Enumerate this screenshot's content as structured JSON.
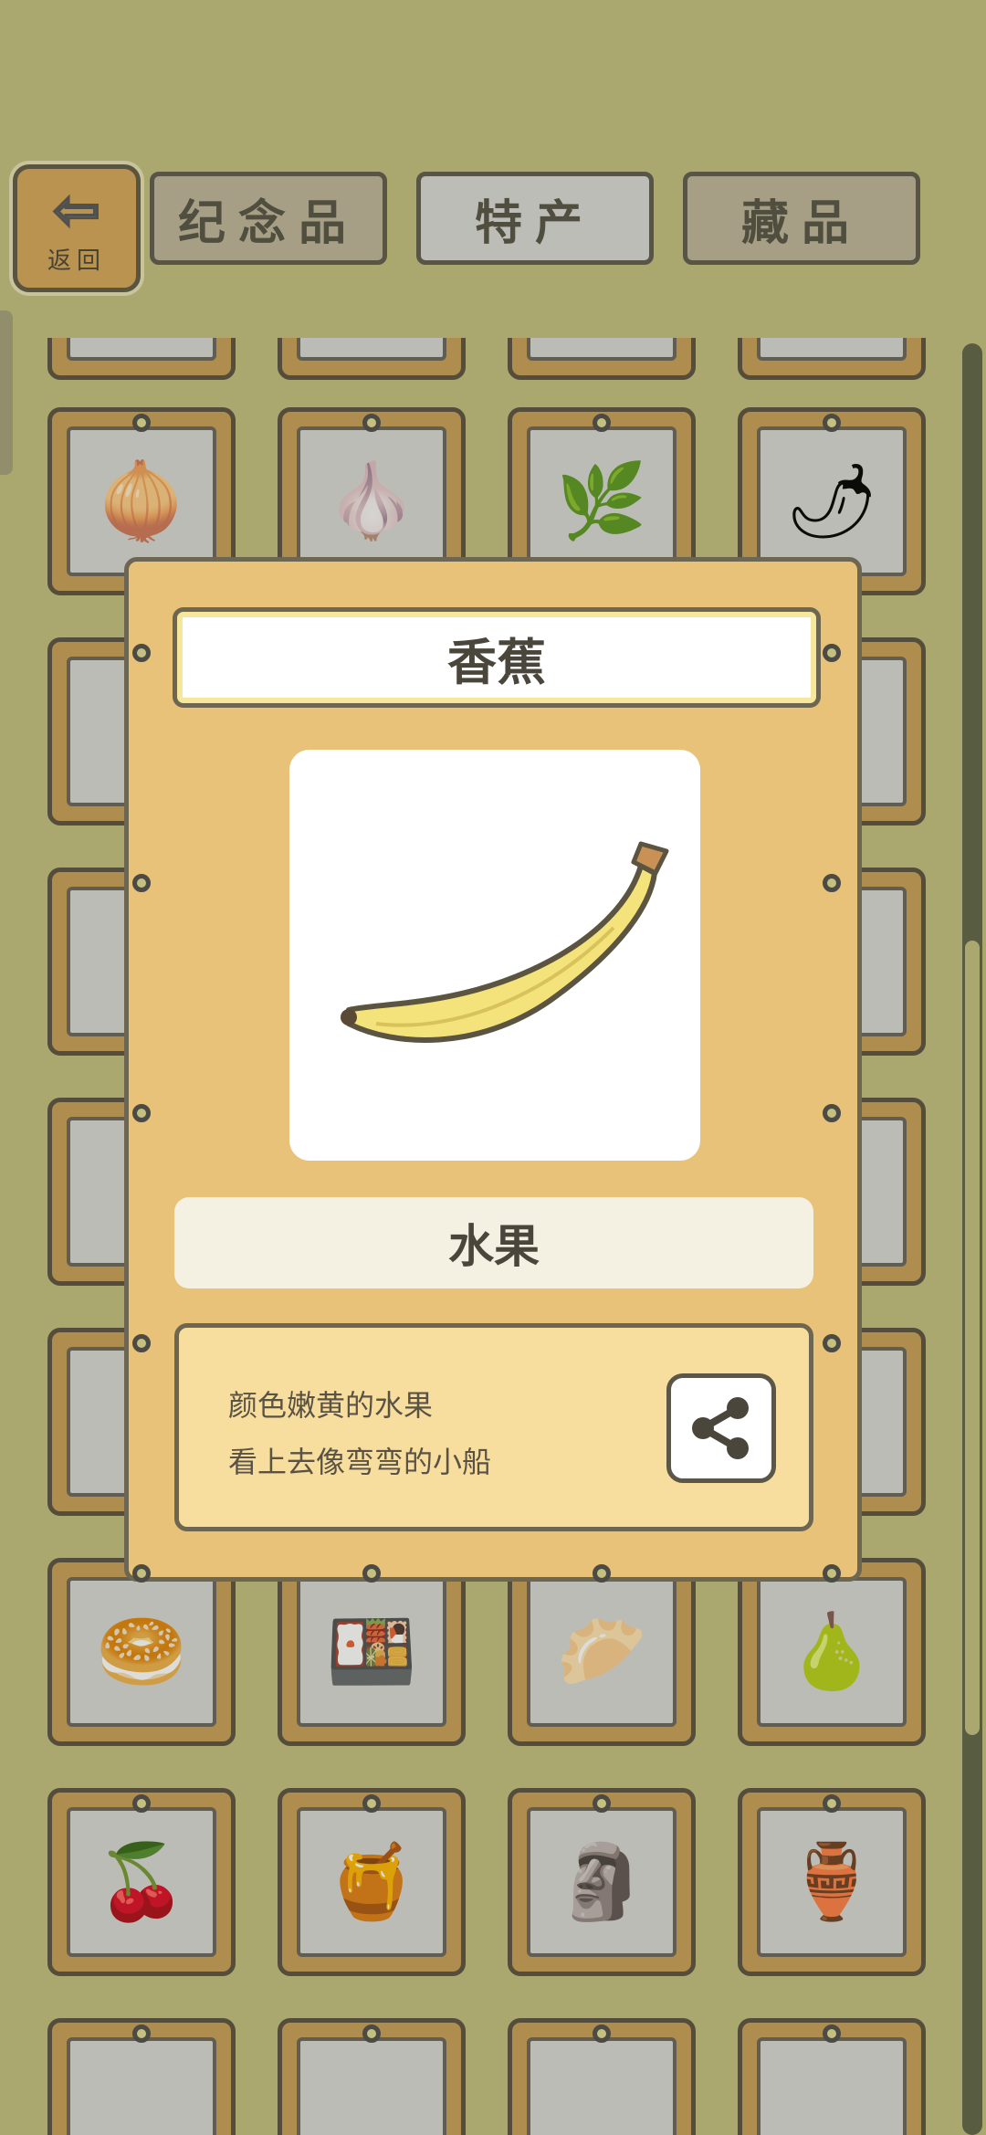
{
  "header": {
    "back_label": "返回",
    "tabs": [
      {
        "label": "纪念品"
      },
      {
        "label": "特产"
      },
      {
        "label": "藏品"
      }
    ]
  },
  "grid": {
    "items": [
      {
        "icon": "onion-icon",
        "glyph": "🧅"
      },
      {
        "icon": "garlic-icon",
        "glyph": "🧄"
      },
      {
        "icon": "scallion-icon",
        "glyph": "🌿"
      },
      {
        "icon": "chili-pepper-icon",
        "glyph": "🌶"
      },
      {
        "icon": "flatbread-icon",
        "glyph": "🥯"
      },
      {
        "icon": "bento-box-icon",
        "glyph": "🍱"
      },
      {
        "icon": "dumplings-plate-icon",
        "glyph": "🥟"
      },
      {
        "icon": "pear-icon",
        "glyph": "🍐"
      },
      {
        "icon": "cherries-icon",
        "glyph": "🍒"
      },
      {
        "icon": "honey-jar-icon",
        "glyph": "🍯"
      },
      {
        "icon": "jade-totem-icon",
        "glyph": "🗿"
      },
      {
        "icon": "pink-totem-icon",
        "glyph": "🏺"
      }
    ]
  },
  "detail": {
    "title": "香蕉",
    "image_icon": "banana-icon",
    "category": "水果",
    "description_lines": [
      "颜色嫩黄的水果",
      "看上去像弯弯的小船"
    ],
    "share_icon": "share-icon"
  },
  "colors": {
    "background": "#c4c07f",
    "modal": "#e9c27a",
    "card_frame": "#c89f58",
    "accent_yellow": "#f4e27a"
  }
}
